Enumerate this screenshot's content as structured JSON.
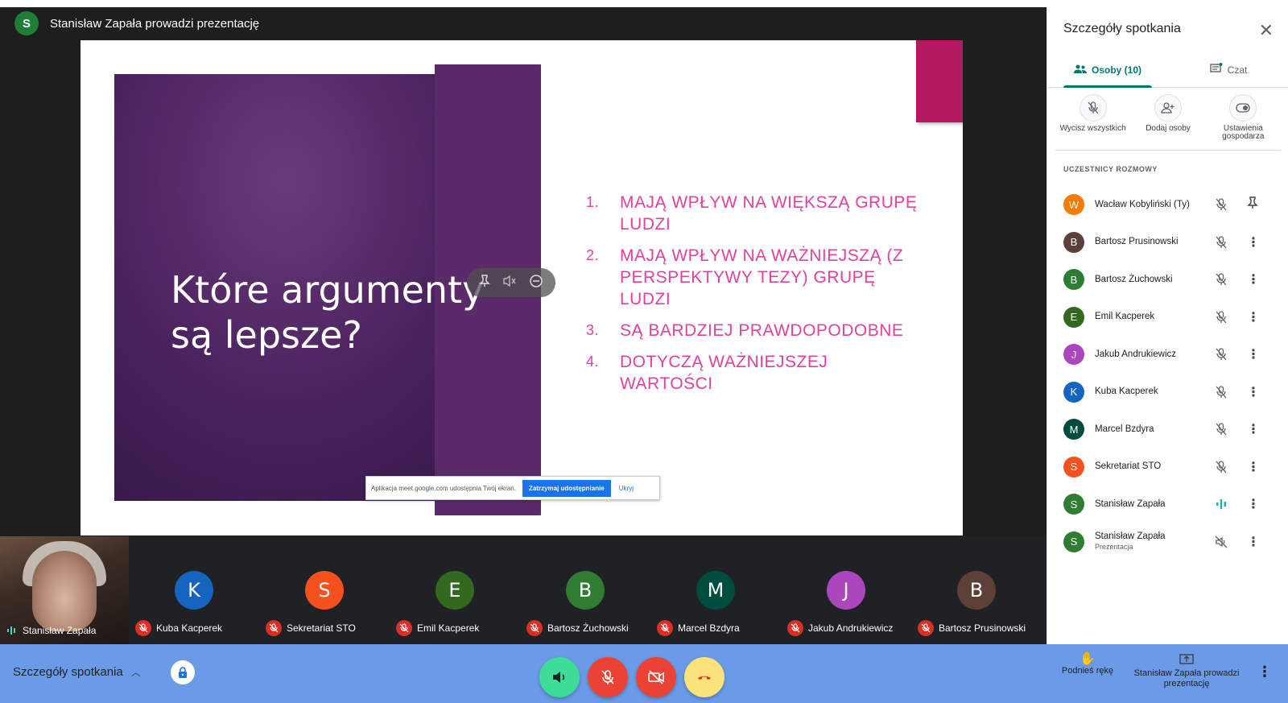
{
  "presenter": {
    "initial": "S",
    "text": "Stanisław Zapała prowadzi prezentację"
  },
  "slide": {
    "title_line1": "Które argumenty",
    "title_line2": "są lepsze?",
    "items": [
      {
        "num": "1.",
        "text": "Mają wpływ na większą grupę ludzi"
      },
      {
        "num": "2.",
        "text": "Mają wpływ na ważniejszą (z perspektywy tezy) grupę ludzi"
      },
      {
        "num": "3.",
        "text": "Są bardziej prawdopodobne"
      },
      {
        "num": "4.",
        "text": "Dotyczą ważniejszej wartości"
      }
    ],
    "accent_color": "#b3195e",
    "text_color": "#e3419a"
  },
  "share_bar": {
    "message": "Aplikacja meet.google.com udostępnia Twój ekran.",
    "stop_label": "Zatrzymaj udostępnianie",
    "hide_label": "Ukryj"
  },
  "strip": {
    "self_name": "Stanisław Zapała",
    "tiles": [
      {
        "initial": "K",
        "name": "Kuba Kacperek",
        "color": "#1565c0"
      },
      {
        "initial": "S",
        "name": "Sekretariat STO",
        "color": "#f4511e"
      },
      {
        "initial": "E",
        "name": "Emil Kacperek",
        "color": "#33691e"
      },
      {
        "initial": "B",
        "name": "Bartosz Żuchowski",
        "color": "#2e7d32"
      },
      {
        "initial": "M",
        "name": "Marcel Bzdyra",
        "color": "#004d40"
      },
      {
        "initial": "J",
        "name": "Jakub Andrukiewicz",
        "color": "#ab47bc"
      },
      {
        "initial": "B",
        "name": "Bartosz Prusinowski",
        "color": "#5d4037"
      }
    ]
  },
  "panel": {
    "title": "Szczegóły spotkania",
    "close_icon": "close-icon",
    "tab_people": "Osoby (10)",
    "tab_chat": "Czat",
    "action_mute": "Wycisz wszystkich",
    "action_add": "Dodaj osoby",
    "action_host": "Ustawienia gospodarza",
    "participants_header": "UCZESTNICY ROZMOWY",
    "participants": [
      {
        "initial": "W",
        "name": "Wacław Kobyliński (Ty)",
        "sub": "",
        "color": "#f57c00",
        "state": "muted",
        "action": "pin"
      },
      {
        "initial": "B",
        "name": "Bartosz Prusinowski",
        "sub": "",
        "color": "#5d4037",
        "state": "muted",
        "action": "more"
      },
      {
        "initial": "B",
        "name": "Bartosz Żuchowski",
        "sub": "",
        "color": "#2e7d32",
        "state": "muted",
        "action": "more"
      },
      {
        "initial": "E",
        "name": "Emil Kacperek",
        "sub": "",
        "color": "#33691e",
        "state": "muted",
        "action": "more"
      },
      {
        "initial": "J",
        "name": "Jakub Andrukiewicz",
        "sub": "",
        "color": "#ab47bc",
        "state": "muted",
        "action": "more"
      },
      {
        "initial": "K",
        "name": "Kuba Kacperek",
        "sub": "",
        "color": "#1565c0",
        "state": "muted",
        "action": "more"
      },
      {
        "initial": "M",
        "name": "Marcel Bzdyra",
        "sub": "",
        "color": "#004d40",
        "state": "muted",
        "action": "more"
      },
      {
        "initial": "S",
        "name": "Sekretariat STO",
        "sub": "",
        "color": "#f4511e",
        "state": "muted",
        "action": "more"
      },
      {
        "initial": "S",
        "name": "Stanisław Zapała",
        "sub": "",
        "color": "#2e7d32",
        "state": "speaking",
        "action": "more"
      },
      {
        "initial": "S",
        "name": "Stanisław Zapała",
        "sub": "Prezentacja",
        "color": "#2e7d32",
        "state": "audio-off",
        "action": "more"
      }
    ]
  },
  "bottom": {
    "details_label": "Szczegóły spotkania",
    "raise_hand": "Podnieś rękę",
    "presenting": "Stanisław Zapała prowadzi prezentację",
    "colors": {
      "speaker": "#3ddc97",
      "mic_off": "#ea4335",
      "cam_off": "#ea4335",
      "hangup": "#fbe27a"
    }
  }
}
